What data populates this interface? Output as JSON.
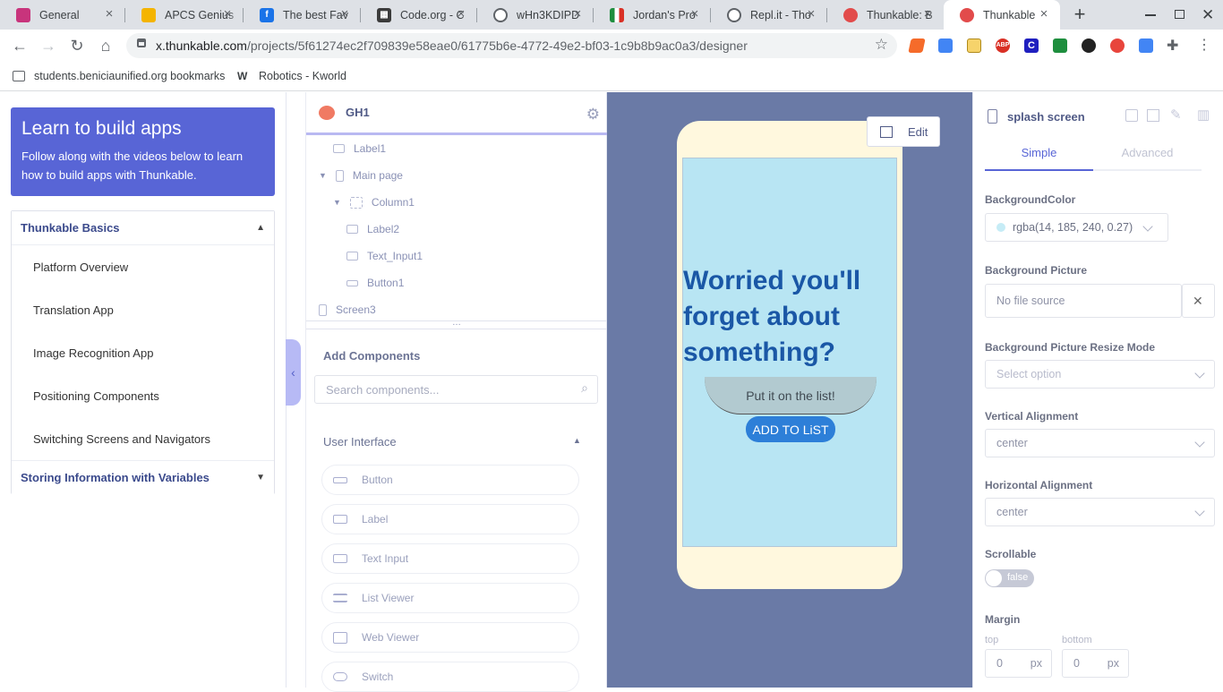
{
  "browser": {
    "tabs": [
      {
        "title": "General",
        "fav_color": "#c8347c",
        "fav_glyph": "▬"
      },
      {
        "title": "APCS Genius",
        "fav_color": "#f4b400",
        "fav_glyph": "▭"
      },
      {
        "title": "The best Fav",
        "fav_color": "#1a73e8",
        "fav_glyph": "f"
      },
      {
        "title": "Code.org - C",
        "fav_color": "#3b3b3b",
        "fav_glyph": "▦"
      },
      {
        "title": "wHn3KDIPD",
        "fav_color": "#5f6368",
        "fav_glyph": "◍"
      },
      {
        "title": "Jordan's Pro",
        "fav_color": "#1e8e3e",
        "fav_glyph": "▮"
      },
      {
        "title": "Repl.it - Tho",
        "fav_color": "#5f6368",
        "fav_glyph": "◉"
      },
      {
        "title": "Thunkable: B",
        "fav_color": "#e24b4b",
        "fav_glyph": "●"
      },
      {
        "title": "Thunkable",
        "fav_color": "#e24b4b",
        "fav_glyph": "●"
      }
    ],
    "new_tab_glyph": "+",
    "url_host": "x.thunkable.com",
    "url_path": "/projects/5f61274ec2f709839e58eae0/61775b6e-4772-49e2-bf03-1c9b8b9ac0a3/designer",
    "bookmarks": [
      {
        "label": "students.beniciaunified.org bookmarks"
      },
      {
        "label": "Robotics - Kworld"
      }
    ]
  },
  "tutorial": {
    "title": "Learn to build apps",
    "subtitle": "Follow along with the videos below to learn how to build apps with Thunkable.",
    "section_open": "Thunkable Basics",
    "items": [
      "Platform Overview",
      "Translation App",
      "Image Recognition App",
      "Positioning Components",
      "Switching Screens and Navigators"
    ],
    "section_closed": "Storing Information with Variables"
  },
  "editor": {
    "project_name": "GH1",
    "tree": [
      {
        "label": "Label1"
      },
      {
        "label": "Main page"
      },
      {
        "label": "Column1"
      },
      {
        "label": "Label2"
      },
      {
        "label": "Text_Input1"
      },
      {
        "label": "Button1"
      },
      {
        "label": "Screen3"
      }
    ],
    "add_components_title": "Add Components",
    "search_placeholder": "Search components...",
    "ui_section": "User Interface",
    "components": [
      "Button",
      "Label",
      "Text Input",
      "List Viewer",
      "Web Viewer",
      "Switch"
    ]
  },
  "canvas": {
    "edit_label": "Edit",
    "headline": "Worried you'll forget about something?",
    "input_placeholder": "Put it on the list!",
    "button_label": "ADD TO LiST",
    "phone_color": "#fff8de",
    "screen_color": "#b8e5f3"
  },
  "properties": {
    "component_name": "splash screen",
    "tab_simple": "Simple",
    "tab_advanced": "Advanced",
    "bg_color_label": "BackgroundColor",
    "bg_color_value": "rgba(14, 185, 240, 0.27)",
    "bg_picture_label": "Background Picture",
    "bg_picture_placeholder": "No file source",
    "resize_label": "Background Picture Resize Mode",
    "resize_placeholder": "Select option",
    "valign_label": "Vertical Alignment",
    "valign_value": "center",
    "halign_label": "Horizontal Alignment",
    "halign_value": "center",
    "scroll_label": "Scrollable",
    "scroll_value": "false",
    "margin_label": "Margin",
    "margin_top_label": "top",
    "margin_bottom_label": "bottom",
    "margin_top_value": "0",
    "margin_bottom_value": "0",
    "unit": "px",
    "accent": "#5865d6"
  }
}
